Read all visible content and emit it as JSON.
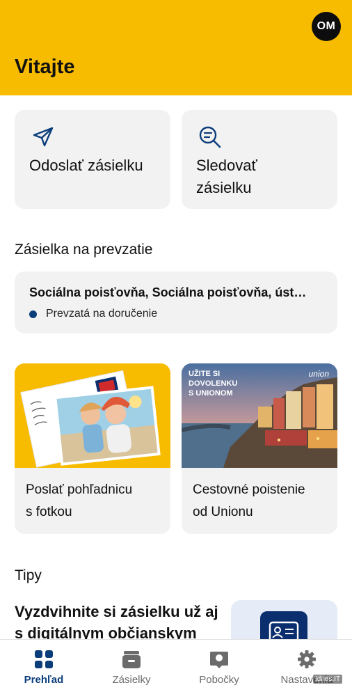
{
  "header": {
    "avatar_initials": "OM",
    "greeting": "Vitajte",
    "background": "#f7bb00"
  },
  "actions": [
    {
      "label": "Odoslať zásielku",
      "icon": "send-icon"
    },
    {
      "label": "Sledovať zásielku",
      "icon": "search-list-icon"
    }
  ],
  "pickup": {
    "section_title": "Zásielka na prevzatie",
    "sender": "Sociálna poisťovňa, Sociálna poisťovňa, úst…",
    "status": "Prevzatá na doručenie",
    "status_color": "#0b3d7a"
  },
  "promos": [
    {
      "title_line1": "Poslať pohľadnicu",
      "title_line2": "s fotkou"
    },
    {
      "title_line1": "Cestovné poistenie",
      "title_line2": "od Unionu",
      "banner_line1": "UŽITE SI",
      "banner_line2": "DOVOLENKU",
      "banner_line3": "S UNIONOM",
      "brand": "union"
    }
  ],
  "tips": {
    "section_title": "Tipy",
    "tip_text": "Vyzdvihnite si zásielku už aj s digitálnym občianskym"
  },
  "nav": [
    {
      "label": "Prehľad",
      "icon": "grid-icon",
      "active": true
    },
    {
      "label": "Zásielky",
      "icon": "box-icon",
      "active": false
    },
    {
      "label": "Pobočky",
      "icon": "map-pin-icon",
      "active": false
    },
    {
      "label": "Nastavenia",
      "icon": "gear-icon",
      "active": false
    }
  ],
  "accent_color": "#0b3d7a",
  "watermark": "Idnes.IT"
}
